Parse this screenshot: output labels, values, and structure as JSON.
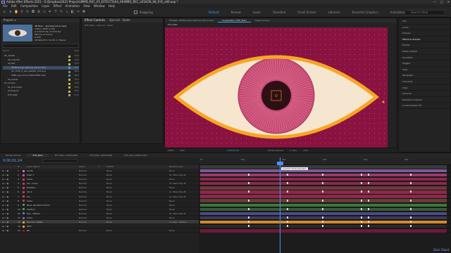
{
  "titlebar": {
    "title": "Adobe After Effects 2021 - E:\\Dropbox\\2021 Projects\\MMD_REC_05_EFFECTS\\04_AE\\MMD_REC_LESSON_08_EYE_a08.aep *",
    "controls": [
      "—",
      "□",
      "✕"
    ]
  },
  "menubar": {
    "items": [
      "File",
      "Edit",
      "Composition",
      "Layer",
      "Effect",
      "Animation",
      "View",
      "Window",
      "Help"
    ]
  },
  "toolbar": {
    "tools": [
      "home-icon",
      "arrow-icon",
      "hand-icon",
      "zoom-icon",
      "rotate-icon",
      "camera-icon",
      "pan-icon",
      "rect-icon",
      "pen-icon",
      "type-icon",
      "brush-icon",
      "stamp-icon",
      "eraser-icon",
      "roto-icon",
      "puppet-icon"
    ],
    "snapping": "Snapping",
    "workspaces": [
      "Default",
      "Review",
      "Learn",
      "Standard",
      "Small Screen",
      "Libraries",
      "Essential Graphics",
      "Animation",
      "Rigging"
    ],
    "active_workspace": "Default",
    "search_placeholder": "Search Help"
  },
  "project": {
    "header": "Project ≡",
    "thumb_info": [
      "48 Blue... opening macro.mp4",
      "1920 x 1080 (1.00)",
      "Δ 0;00;07;00, 23.976 fps",
      "Millions of Colors",
      "H.264",
      "48.000 kHz / 32 bit U / Stereo"
    ],
    "columns": [
      "Name",
      "Type"
    ],
    "items": [
      {
        "name": "01_Assets",
        "type": "Fold",
        "color": "#c8b44a",
        "indent": 0
      },
      {
        "name": "00_Imports",
        "type": "Fold",
        "color": "#c8b44a",
        "indent": 1
      },
      {
        "name": "02_Ref",
        "type": "Fold",
        "color": "#c8b44a",
        "indent": 1
      },
      {
        "name": "48 Blue eye opening macro.mp4",
        "type": "MP4",
        "color": "#4a9ac8",
        "indent": 2,
        "selected": true
      },
      {
        "name": "LS_1234_5_eye_palette_v01.png",
        "type": "PNG",
        "color": "#9a8a5a",
        "indent": 2
      },
      {
        "name": "MMD_eye_final_1920x1080.mp4",
        "type": "MP4",
        "color": "#4a9ac8",
        "indent": 2
      },
      {
        "name": "02_Solids",
        "type": "Fold",
        "color": "#c8b44a",
        "indent": 1
      },
      {
        "name": "03_Comps",
        "type": "Fold",
        "color": "#c8b44a",
        "indent": 0
      },
      {
        "name": "01_Precomps",
        "type": "Fold",
        "color": "#c8b44a",
        "indent": 1
      },
      {
        "name": "02_Export",
        "type": "Fold",
        "color": "#c8b44a",
        "indent": 1
      },
      {
        "name": "EYE_Main",
        "type": "Com",
        "color": "#9a9aa0",
        "indent": 1
      }
    ]
  },
  "effects": {
    "tabs": [
      "Effect Controls",
      "Eye Lid - Outer"
    ],
    "header": "EYE_Main • Eye Lid - Outer"
  },
  "comp": {
    "tabs": [
      "Footage: 48 Blue eye opening macro.mp4",
      "Composition: EYE_Main",
      "Layer: (none)"
    ],
    "breadcrumb": "EYE_Main",
    "colors": {
      "bg": "#8a1240",
      "dots": "#c44d7a",
      "orange": "#f7a623",
      "sclera": "#f6e6d0",
      "iris": "#c74a72",
      "iris_line": "#e27b9c",
      "pupil": "#2d0f14"
    },
    "viewer": {
      "zoom": "100%",
      "res": "Half",
      "time": "0;00;01;24",
      "camera": "Active Camera",
      "views": "1 View",
      "exposure": "+0.0"
    }
  },
  "right_panel": {
    "items": [
      "Info",
      "Audio",
      "Preview",
      "Effects & Presets",
      "Tracker",
      "Motion Sketch",
      "Smoother",
      "Wiggler",
      "Align",
      "Paragraph",
      "Character",
      "Align",
      "Libraries",
      "Essential Graphics",
      "Content-Aware Fill"
    ],
    "bold_index": 3
  },
  "timeline": {
    "tabs": [
      "Render Queue",
      "EYE_Main",
      "EYE_Main 1920x1080",
      "EYE_Main 1080x1080",
      "EYE_Main 1080x1920"
    ],
    "active_tab": 1,
    "timecode": "0;00;01;24",
    "columns": [
      "#",
      "Layer Name",
      "Mode",
      "T",
      "TrkMat",
      "Parent & Link"
    ],
    "ruler_labels": [
      "0f",
      "01s",
      "02s",
      "03s",
      "04s",
      "05s"
    ],
    "cti_tooltip": "Current Time Indicator",
    "layers": [
      {
        "num": "1",
        "name": "Guide",
        "mode": "Normal",
        "trk": "None",
        "parent": "None",
        "color": "#a57fd0",
        "bar": "#7a5a9a"
      },
      {
        "num": "2",
        "name": "Pupil 1",
        "mode": "Normal",
        "trk": "None",
        "parent": "12. NULL Eye M",
        "color": "#d04a8a",
        "bar": "#9a3a6a"
      },
      {
        "num": "3",
        "name": "Scale",
        "mode": "Normal",
        "trk": "None",
        "parent": "None",
        "color": "#c03a5a",
        "bar": "#8a2a4a"
      },
      {
        "num": "4",
        "name": "Iris - Lines",
        "mode": "Normal",
        "trk": "None",
        "parent": "12. NULL Eye M",
        "color": "#c03a5a",
        "bar": "#8a2a4a"
      },
      {
        "num": "5",
        "name": "Rotation",
        "mode": "Normal",
        "trk": "None",
        "parent": "None",
        "color": "#c03a5a",
        "bar": "#6a3a3a"
      },
      {
        "num": "6",
        "name": "Iris 2",
        "mode": "Normal",
        "trk": "None",
        "parent": "12. NULL Eye M",
        "color": "#c03a5a",
        "bar": "#8a2a4a"
      },
      {
        "num": "7",
        "name": "Iris",
        "mode": "Normal",
        "trk": "None",
        "parent": "12. NULL Eye M",
        "color": "#c03a5a",
        "bar": "#8a2a4a"
      },
      {
        "num": "8",
        "name": "Scale",
        "mode": "Normal",
        "trk": "None",
        "parent": "None",
        "color": "#c03a5a",
        "bar": "#6a3a3a"
      },
      {
        "num": "9",
        "name": "NULL Eye Ball Control",
        "mode": "Normal",
        "trk": "None",
        "parent": "None",
        "color": "#4a9a4a",
        "bar": "#3a7a3a"
      },
      {
        "num": "10",
        "name": "Position",
        "mode": "Normal",
        "trk": "None",
        "parent": "None",
        "color": "#4a9a4a",
        "bar": "#3a5a3a"
      },
      {
        "num": "11",
        "name": "Eye - Whites",
        "mode": "Normal",
        "trk": "None",
        "parent": "12. NULL Eye M",
        "color": "#6a6ac0",
        "bar": "#4a4a8a"
      },
      {
        "num": "12",
        "name": "Scale",
        "mode": "Normal",
        "trk": "None",
        "parent": "None",
        "color": "#6a6ac0",
        "bar": "#3a3a5a"
      },
      {
        "num": "13",
        "name": "Eye Lid - Outer",
        "mode": "Normal",
        "trk": "None",
        "parent": "14. Eye - Whites",
        "color": "#e09a30",
        "bar": "#d4882a",
        "selected": true
      },
      {
        "num": "14",
        "name": "Path",
        "mode": "",
        "trk": "",
        "parent": "",
        "color": "#e09a30",
        "bar": "#2a2a2a"
      },
      {
        "num": "15",
        "name": "BG",
        "mode": "Normal",
        "trk": "None",
        "parent": "None",
        "color": "#8a1240",
        "bar": "#6a1a3a"
      }
    ]
  },
  "brand": "Dani Cloud"
}
